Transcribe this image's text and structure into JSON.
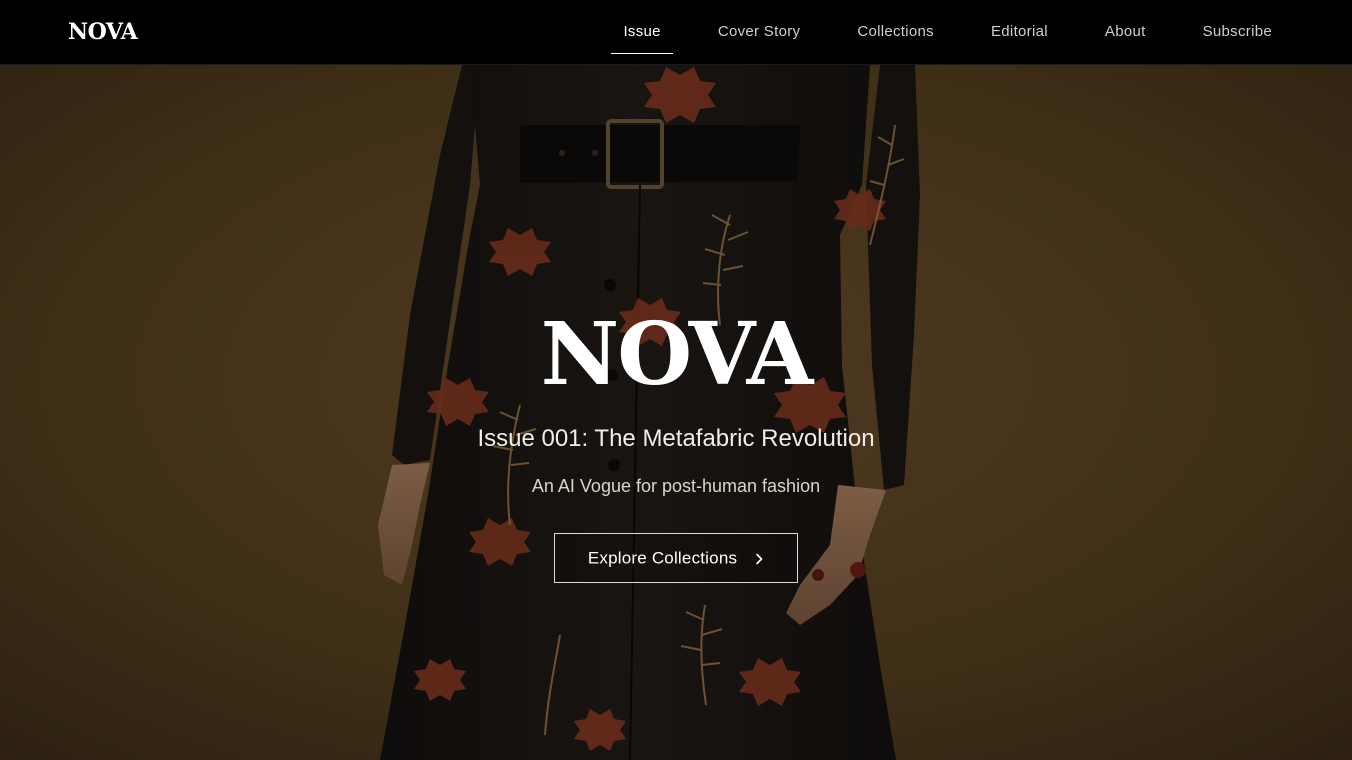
{
  "navbar": {
    "brand": "NOVA",
    "links": [
      {
        "label": "Issue",
        "active": true
      },
      {
        "label": "Cover Story"
      },
      {
        "label": "Collections"
      },
      {
        "label": "Editorial"
      },
      {
        "label": "About"
      },
      {
        "label": "Subscribe"
      }
    ]
  },
  "hero": {
    "title": "NOVA",
    "issue": "Issue 001: The Metafabric Revolution",
    "tagline": "An AI Vogue for post-human fashion",
    "cta_label": "Explore Collections",
    "cta_icon": "chevron-right-icon"
  },
  "colors": {
    "nav_background": "#000000",
    "hero_background": "#4a3620",
    "coat": "#1a1612",
    "floral_red": "#8a3a22",
    "floral_tan": "#a47d4a"
  }
}
